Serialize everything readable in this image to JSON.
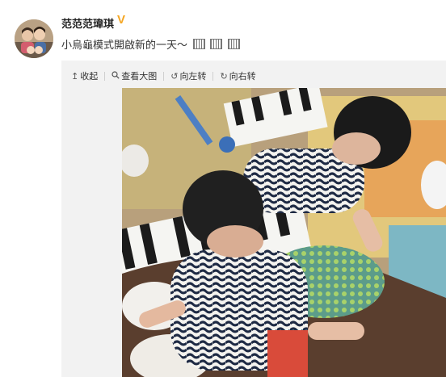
{
  "user": {
    "name": "范范范瑋琪",
    "verified_badge": "V",
    "avatar_icon": "avatar-photo"
  },
  "post": {
    "text": "小烏龜模式開啟新的一天～",
    "emoticons": [
      "emoticon",
      "emoticon",
      "emoticon"
    ]
  },
  "toolbar": {
    "collapse_label": "收起",
    "view_large_label": "查看大图",
    "rotate_left_label": "向左转",
    "rotate_right_label": "向右转",
    "collapse_icon": "collapse-up-icon",
    "view_large_icon": "magnifier-icon",
    "rotate_left_icon": "rotate-left-icon",
    "rotate_right_icon": "rotate-right-icon"
  },
  "colors": {
    "verified": "#f5a623",
    "panel": "#f2f2f2"
  }
}
